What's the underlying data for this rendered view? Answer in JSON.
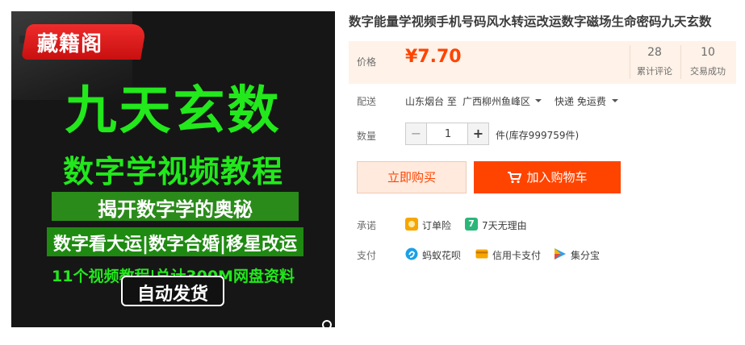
{
  "product_image": {
    "brand": "藏籍阁",
    "headline": "九天玄数",
    "subhead": "数字学视频教程",
    "reveal": "揭开数字学的奥秘",
    "fortune": "数字看大运|数字合婚|移星改运",
    "course": "11个视频教程|总计300M网盘资料",
    "auto_delivery": "自动发货",
    "zoom_icon": "magnifier-icon"
  },
  "product": {
    "title": "数字能量学视频手机号码风水转运改运数字磁场生命密码九天玄数"
  },
  "price_section": {
    "label": "价格",
    "price": "¥7.70",
    "reviews_count": "28",
    "reviews_label": "累计评论",
    "sales_count": "10",
    "sales_label": "交易成功"
  },
  "delivery": {
    "label": "配送",
    "from": "山东烟台 至",
    "to": "广西柳州鱼峰区",
    "shipping": "快递 免运费"
  },
  "quantity": {
    "label": "数量",
    "value": "1",
    "minus": "−",
    "plus": "+",
    "stock": "件(库存999759件)"
  },
  "actions": {
    "buy_now": "立即购买",
    "add_to_cart": "加入购物车"
  },
  "promises": {
    "label": "承诺",
    "items": [
      {
        "icon": "order-insurance-icon",
        "text": "订单险"
      },
      {
        "icon": "seven-day-return-icon",
        "badge": "7",
        "text": "7天无理由"
      }
    ]
  },
  "payment": {
    "label": "支付",
    "methods": [
      {
        "icon": "huabei-icon",
        "text": "蚂蚁花呗"
      },
      {
        "icon": "credit-card-icon",
        "text": "信用卡支付"
      },
      {
        "icon": "jifenbao-icon",
        "text": "集分宝"
      }
    ]
  },
  "colors": {
    "accent": "#ff4400",
    "price_bg": "#fff2e8",
    "poster_green": "#22e81c",
    "brand_red": "#d81818"
  }
}
